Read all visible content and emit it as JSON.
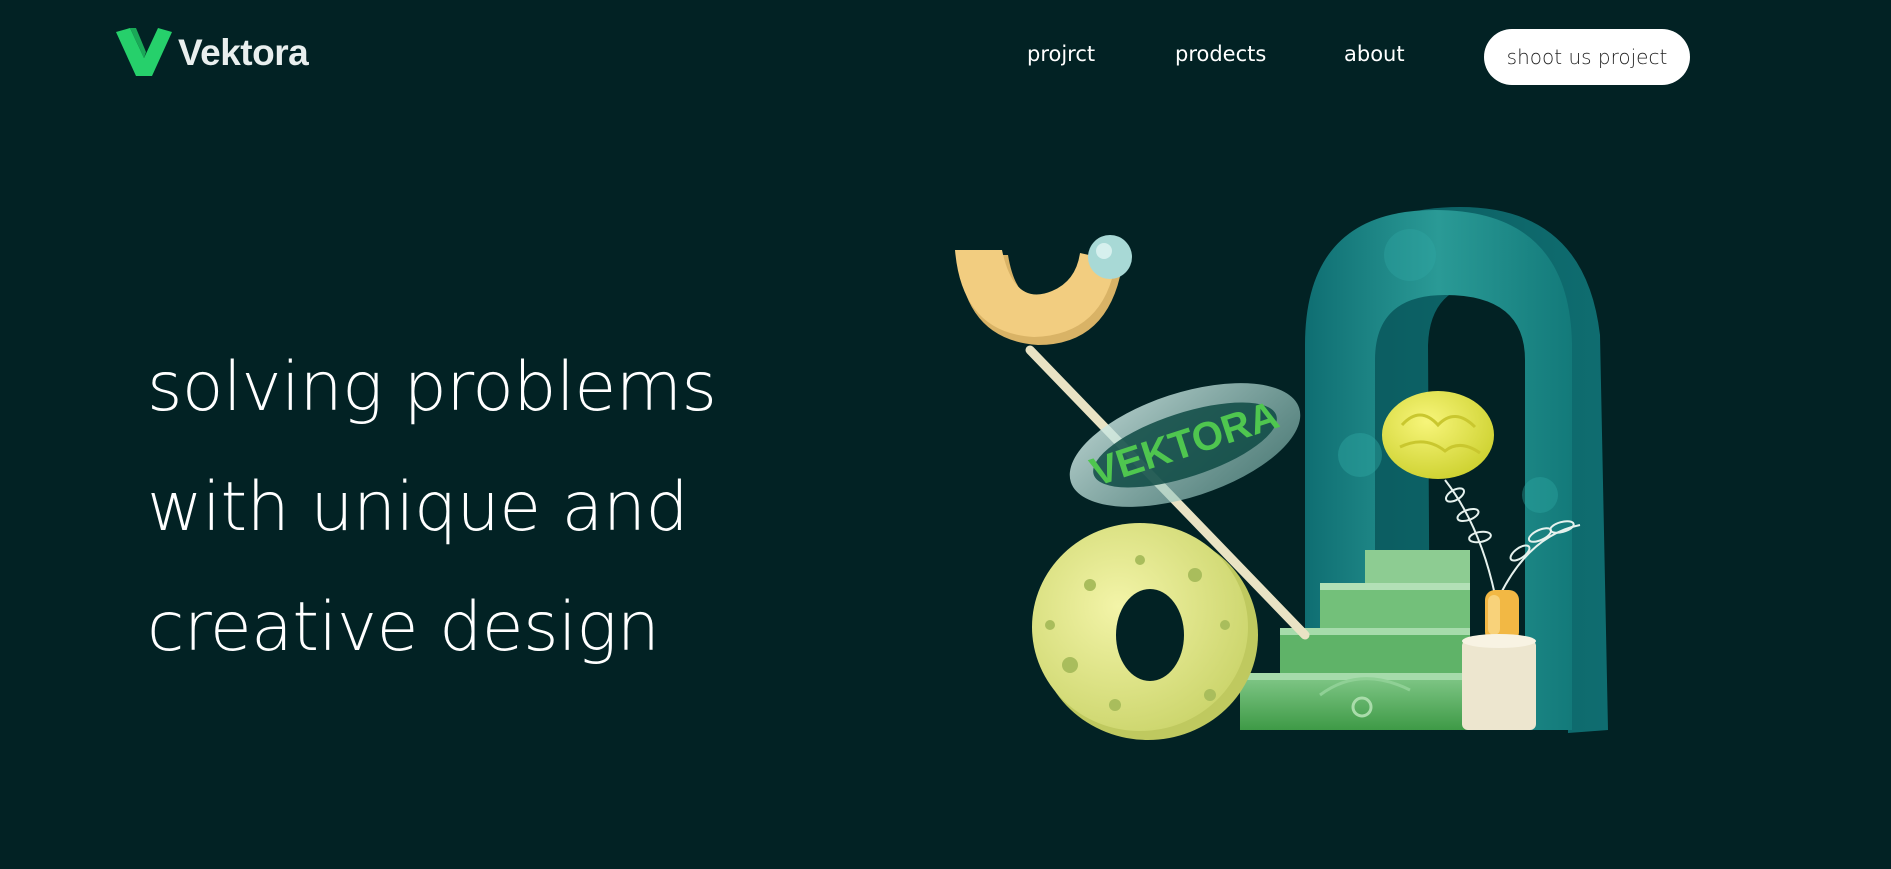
{
  "brand": {
    "name": "Vektora",
    "accent": "#26d06b"
  },
  "nav": {
    "items": [
      {
        "label": "projrct"
      },
      {
        "label": "prodects"
      },
      {
        "label": "about"
      }
    ],
    "cta_label": "shoot us project"
  },
  "hero": {
    "lines": [
      "solving problems",
      "with unique and",
      "creative design"
    ]
  },
  "illustration": {
    "ring_text": "VEKTORA",
    "colors": {
      "background": "#022224",
      "arch": "#1c8a8a",
      "yellow": "#e6e98a",
      "green": "#3fa04a",
      "orange": "#f0c070"
    }
  }
}
